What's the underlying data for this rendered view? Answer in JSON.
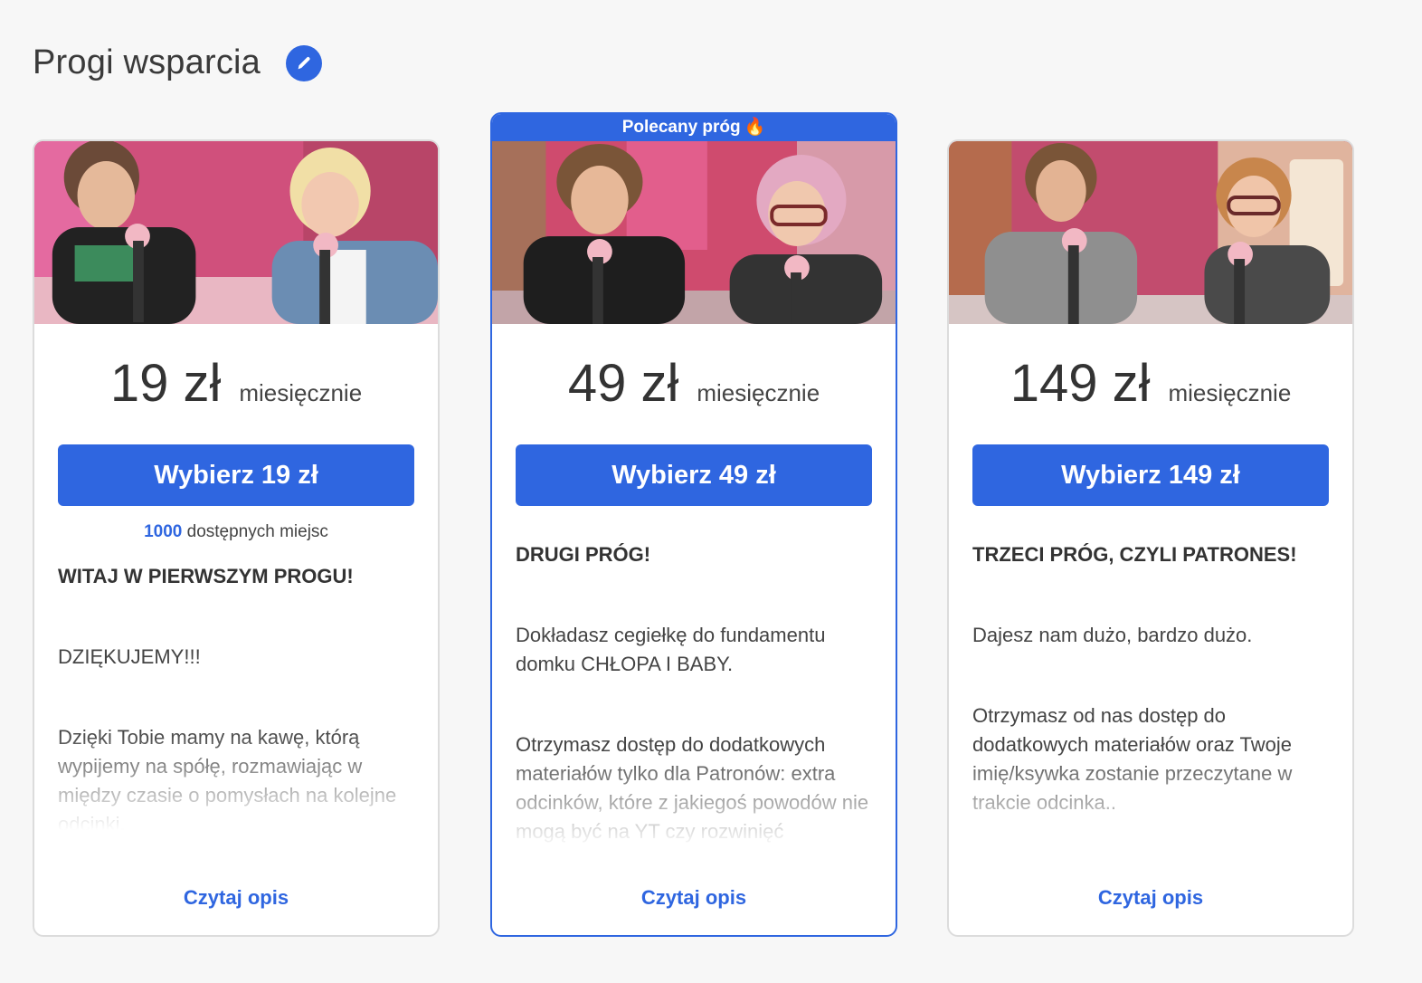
{
  "header": {
    "title": "Progi wsparcia",
    "edit_icon": "pencil-icon"
  },
  "colors": {
    "accent": "#2f66e0",
    "card_border": "#dcdcdc",
    "background": "#f7f7f7"
  },
  "tiers": [
    {
      "price": "19 zł",
      "period": "miesięcznie",
      "button_label": "Wybierz 19 zł",
      "slots_count": "1000",
      "slots_label": "dostępnych miejsc",
      "heading": "WITAJ W PIERWSZYM PROGU!",
      "paragraphs": [
        "DZIĘKUJEMY!!!",
        "Dzięki Tobie mamy na kawę, którą wypijemy na spółę, rozmawiając w między czasie o pomysłach na kolejne odcinki."
      ],
      "read_more": "Czytaj opis"
    },
    {
      "badge": "Polecany próg",
      "badge_icon": "fire-icon",
      "price": "49 zł",
      "period": "miesięcznie",
      "button_label": "Wybierz 49 zł",
      "heading": "DRUGI PRÓG!",
      "paragraphs": [
        "Dokładasz cegiełkę do fundamentu domku CHŁOPA I BABY.",
        "Otrzymasz dostęp do dodatkowych materiałów tylko dla Patronów: extra odcinków, które z jakiegoś powodów nie mogą być na YT czy rozwinięć"
      ],
      "read_more": "Czytaj opis"
    },
    {
      "price": "149 zł",
      "period": "miesięcznie",
      "button_label": "Wybierz 149 zł",
      "heading": "TRZECI PRÓG, CZYLI PATRONES!",
      "paragraphs": [
        "Dajesz nam dużo, bardzo dużo.",
        "Otrzymasz od nas dostęp do dodatkowych materiałów oraz Twoje imię/ksywka zostanie przeczytane w trakcie odcinka.."
      ],
      "read_more": "Czytaj opis"
    }
  ]
}
